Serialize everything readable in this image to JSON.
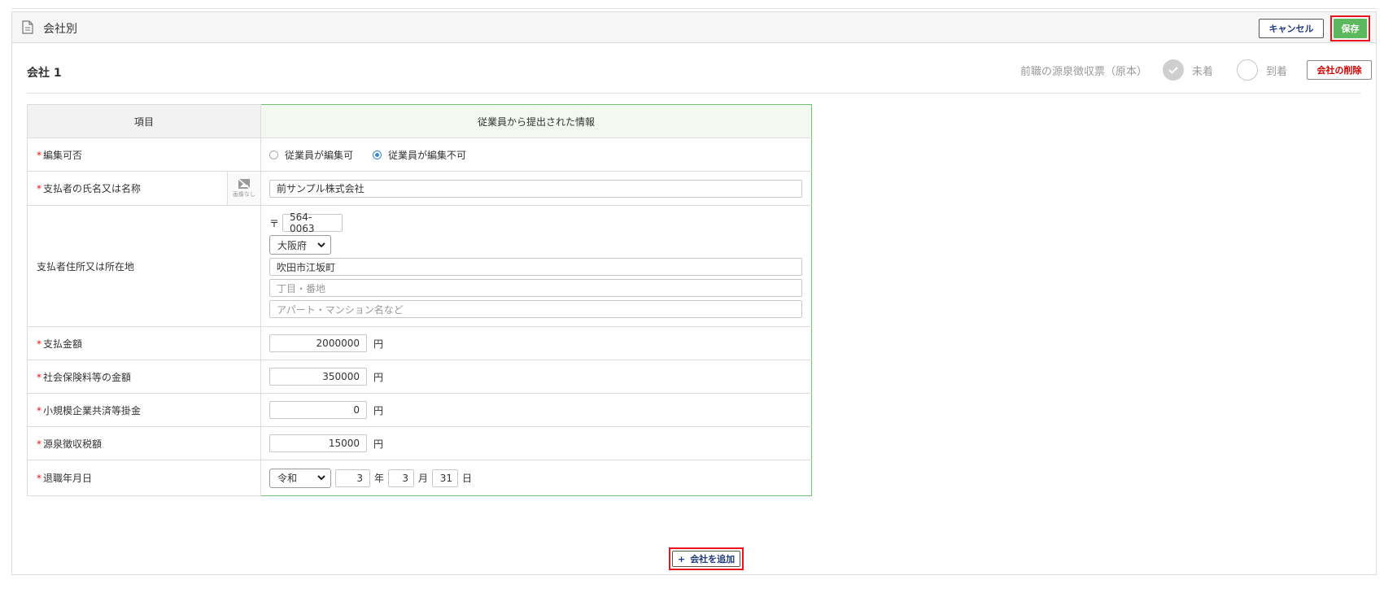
{
  "header": {
    "title": "会社別",
    "doc_icon": "document-icon",
    "cancel_label": "キャンセル",
    "save_label": "保存"
  },
  "company": {
    "title": "会社 1",
    "receipt_label": "前職の源泉徴収票（原本）",
    "status_unarrived": "未着",
    "status_arrived": "到着",
    "delete_label": "会社の削除"
  },
  "table": {
    "col_item": "項目",
    "col_info": "従業員から提出された情報",
    "rows": {
      "editable": {
        "label": "編集可否",
        "option_editable": "従業員が編集可",
        "option_not_editable": "従業員が編集不可",
        "selected": "従業員が編集不可"
      },
      "payer_name": {
        "label": "支払者の氏名又は名称",
        "no_image": "画像なし",
        "value": "前サンプル株式会社"
      },
      "payer_address": {
        "label": "支払者住所又は所在地",
        "postal_mark": "〒",
        "postal_code": "564-0063",
        "prefecture": "大阪府",
        "city": "吹田市江坂町",
        "block_placeholder": "丁目・番地",
        "building_placeholder": "アパート・マンション名など"
      },
      "payment": {
        "label": "支払金額",
        "value": "2000000",
        "unit": "円"
      },
      "social_insurance": {
        "label": "社会保険料等の金額",
        "value": "350000",
        "unit": "円"
      },
      "small_business": {
        "label": "小規模企業共済等掛金",
        "value": "0",
        "unit": "円"
      },
      "withholding": {
        "label": "源泉徴収税額",
        "value": "15000",
        "unit": "円"
      },
      "retirement_date": {
        "label": "退職年月日",
        "era": "令和",
        "year": "3",
        "year_unit": "年",
        "month": "3",
        "month_unit": "月",
        "day": "31",
        "day_unit": "日"
      }
    },
    "required_mark": "*"
  },
  "footer": {
    "add_label": "会社を追加",
    "add_icon": "+"
  },
  "colors": {
    "save_green": "#5cb85c",
    "highlight_red": "#e8141c",
    "delete_red": "#cc0000",
    "info_green_border": "#6fbf6f"
  }
}
